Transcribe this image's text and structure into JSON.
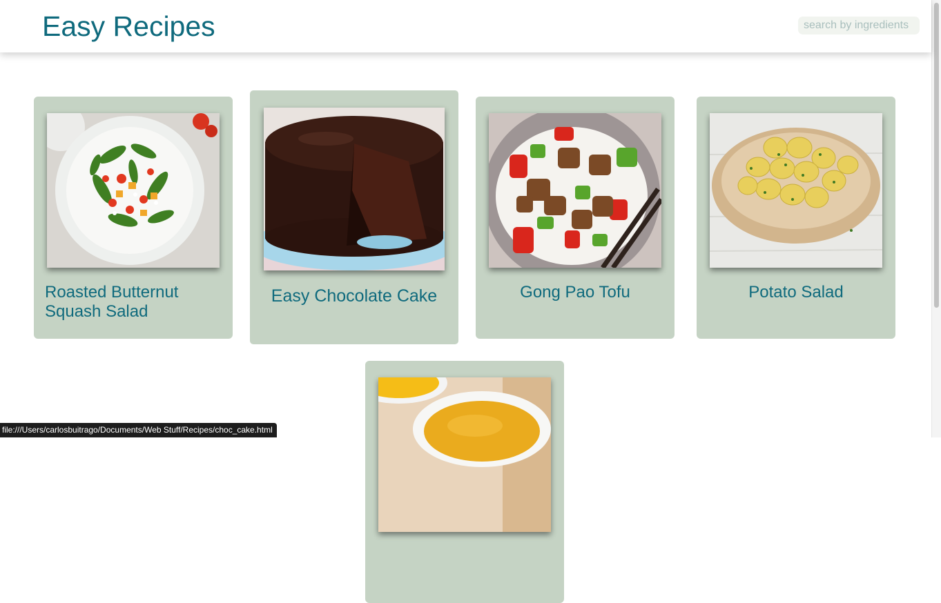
{
  "header": {
    "title": "Easy Recipes",
    "search_placeholder": "search by ingredients"
  },
  "recipes": [
    {
      "name": "Roasted Butternut Squash Salad",
      "image": "salad-photo"
    },
    {
      "name": "Easy Chocolate Cake",
      "image": "chocolate-cake-photo"
    },
    {
      "name": "Gong Pao Tofu",
      "image": "tofu-stir-fry-photo"
    },
    {
      "name": "Potato Salad",
      "image": "potato-salad-photo"
    },
    {
      "name": "",
      "image": "soup-photo"
    }
  ],
  "status_bar": {
    "url": "file:///Users/carlosbuitrago/Documents/Web Stuff/Recipes/choc_cake.html"
  },
  "colors": {
    "title": "#0f6a7d",
    "card_background": "#c5d3c4",
    "search_background": "#f1f4ef"
  }
}
